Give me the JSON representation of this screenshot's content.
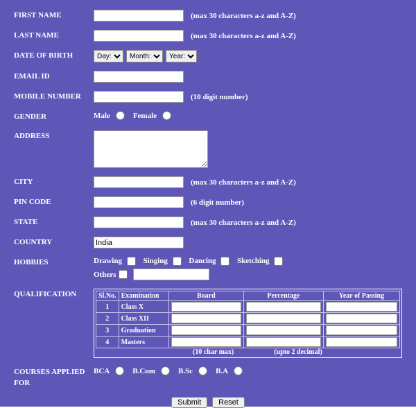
{
  "labels": {
    "first_name": "FIRST NAME",
    "last_name": "LAST NAME",
    "dob": "DATE OF BIRTH",
    "email": "EMAIL ID",
    "mobile": "MOBILE NUMBER",
    "gender": "GENDER",
    "address": "ADDRESS",
    "city": "CITY",
    "pin": "PIN CODE",
    "state": "STATE",
    "country": "COUNTRY",
    "hobbies": "HOBBIES",
    "qualification": "QUALIFICATION",
    "courses": "COURSES APPLIED FOR"
  },
  "hints": {
    "name30": "(max 30 characters a-z and A-Z)",
    "mobile": "(10 digit number)",
    "pin": "(6 digit number)",
    "board": "(10 char max)",
    "percentage": "(upto 2 decimal)"
  },
  "dob": {
    "day": "Day:",
    "month": "Month:",
    "year": "Year:"
  },
  "gender": {
    "male": "Male",
    "female": "Female"
  },
  "country_value": "India",
  "hobbies": {
    "drawing": "Drawing",
    "singing": "Singing",
    "dancing": "Dancing",
    "sketching": "Sketching",
    "others": "Others"
  },
  "qual_headers": {
    "slno": "Sl.No.",
    "exam": "Examination",
    "board": "Board",
    "percentage": "Percentage",
    "year": "Year of Passing"
  },
  "qual_rows": [
    {
      "no": "1",
      "exam": "Class X"
    },
    {
      "no": "2",
      "exam": "Class XII"
    },
    {
      "no": "3",
      "exam": "Graduation"
    },
    {
      "no": "4",
      "exam": "Masters"
    }
  ],
  "courses": {
    "bca": "BCA",
    "bcom": "B.Com",
    "bsc": "B.Sc",
    "ba": "B.A"
  },
  "buttons": {
    "submit": "Submit",
    "reset": "Reset"
  }
}
